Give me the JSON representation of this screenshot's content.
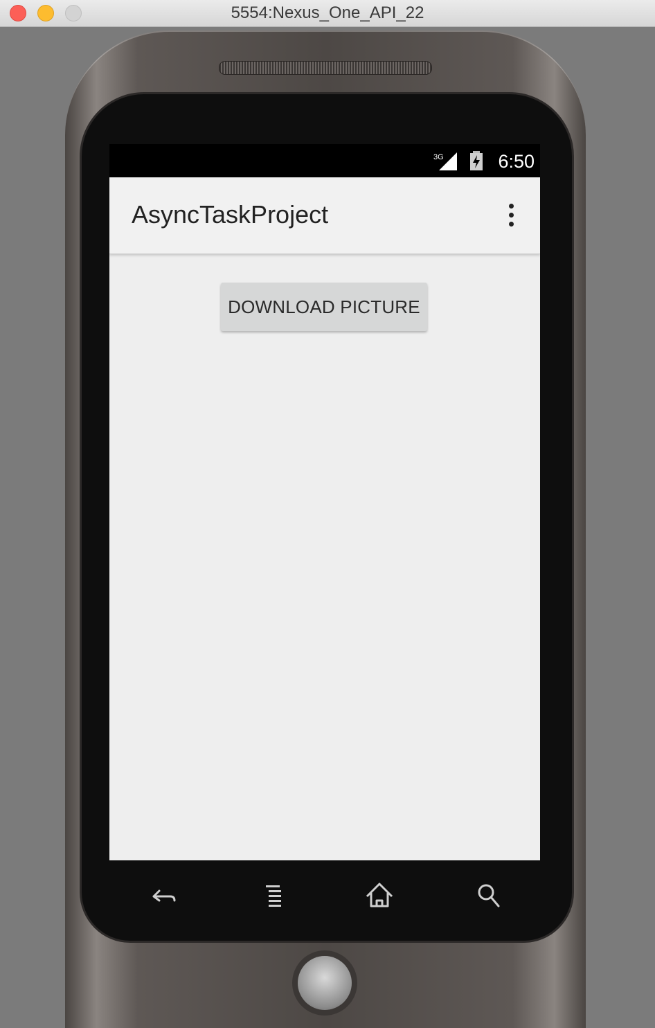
{
  "window": {
    "title": "5554:Nexus_One_API_22"
  },
  "status_bar": {
    "network": "3G",
    "time": "6:50"
  },
  "app_bar": {
    "title": "AsyncTaskProject",
    "menu_icon": "overflow-menu-icon"
  },
  "content": {
    "download_button_label": "DOWNLOAD PICTURE"
  },
  "hardware_keys": [
    {
      "name": "back",
      "icon": "back-arrow-icon"
    },
    {
      "name": "menu",
      "icon": "menu-lines-icon"
    },
    {
      "name": "home",
      "icon": "home-icon"
    },
    {
      "name": "search",
      "icon": "search-icon"
    }
  ]
}
